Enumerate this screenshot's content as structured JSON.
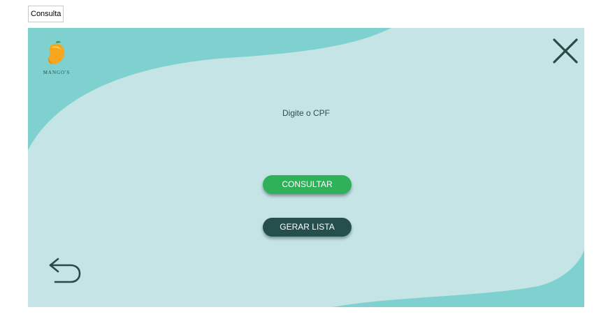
{
  "tab": {
    "label": "Consulta"
  },
  "logo": {
    "wordmark": "MANGO'S"
  },
  "form": {
    "prompt": "Digite o CPF"
  },
  "buttons": {
    "consultar": "CONSULTAR",
    "gerar_lista": "GERAR LISTA"
  },
  "icons": {
    "close": "close-icon",
    "back": "undo-arrow-icon",
    "logo": "mango-icon"
  },
  "colors": {
    "background": "#c4e4e5",
    "wave": "#7fd1d0",
    "primary_green": "#2fb15a",
    "dark_teal": "#254f4d"
  }
}
